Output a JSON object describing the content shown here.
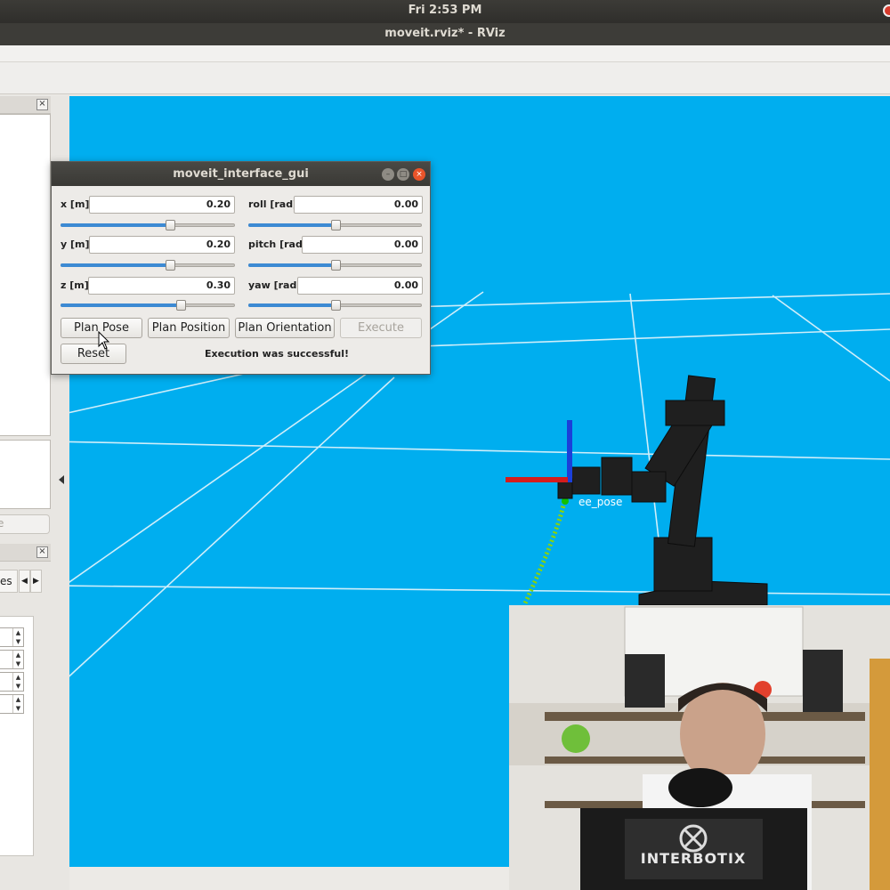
{
  "system_bar": {
    "clock": "Fri  2:53 PM"
  },
  "window": {
    "title": "moveit.rviz* - RViz"
  },
  "left_dock": {
    "panel_button_partial": "e",
    "tab_partial": "es",
    "tab_prev_icon": "chevron-left-icon",
    "tab_next_icon": "chevron-right-icon"
  },
  "viewport": {
    "background_color": "#00aeef",
    "frame_label": "ee_pose"
  },
  "dialog": {
    "title": "moveit_interface_gui",
    "fields": [
      {
        "label": "x [m]",
        "value": "0.20",
        "slider_fraction": 0.63
      },
      {
        "label": "y [m]",
        "value": "0.20",
        "slider_fraction": 0.63
      },
      {
        "label": "z [m]",
        "value": "0.30",
        "slider_fraction": 0.69
      },
      {
        "label": "roll [rad]",
        "value": "0.00",
        "slider_fraction": 0.5
      },
      {
        "label": "pitch [rad]",
        "value": "0.00",
        "slider_fraction": 0.5
      },
      {
        "label": "yaw [rad]",
        "value": "0.00",
        "slider_fraction": 0.5
      }
    ],
    "buttons": {
      "plan_pose": "Plan Pose",
      "plan_position": "Plan Position",
      "plan_orientation": "Plan Orientation",
      "execute": "Execute",
      "reset": "Reset"
    },
    "status": "Execution was successful!"
  },
  "webcam": {
    "logo_text": "INTERBOTIX"
  }
}
